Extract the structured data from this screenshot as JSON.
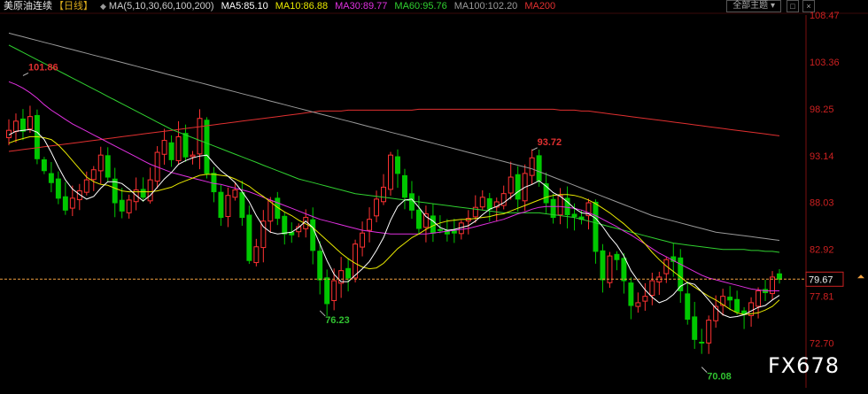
{
  "header": {
    "title": "美原油连续",
    "period": "【日线】",
    "ma_label": "MA(5,10,30,60,100,200)",
    "ma5": "MA5:85.10",
    "ma10": "MA10:86.88",
    "ma30": "MA30:89.77",
    "ma60": "MA60:95.76",
    "ma100": "MA100:102.20",
    "ma200": "MA200",
    "theme_button": "全部主题",
    "theme_icon": "chevron-down-icon",
    "icons": [
      "square-icon",
      "close-icon"
    ]
  },
  "colors": {
    "up": "#ff3232",
    "down": "#00c800",
    "ma5": "#ffffff",
    "ma10": "#e8e800",
    "ma30": "#e030e0",
    "ma60": "#30d030",
    "ma100": "#9a9a9a",
    "ma200": "#e03030",
    "last_price": "#f0a040"
  },
  "watermark": "FX678",
  "chart_data": {
    "type": "candlestick",
    "y_axis": {
      "min": 68.5,
      "max": 108.47,
      "position": "right",
      "ticks": [
        108.47,
        103.36,
        98.25,
        93.14,
        88.03,
        82.92,
        77.81,
        72.7
      ]
    },
    "last_price": 79.67,
    "annotations": [
      {
        "text": "101.86",
        "index": 2,
        "value": 101.86
      },
      {
        "text": "93.72",
        "index": 74,
        "value": 93.72
      },
      {
        "text": "76.23",
        "index": 44,
        "value": 76.23
      },
      {
        "text": "70.08",
        "index": 98,
        "value": 70.08
      }
    ],
    "close": [
      95.9,
      96.9,
      95.8,
      97.4,
      92.8,
      91.5,
      90.2,
      88.5,
      87.2,
      88.5,
      89.3,
      90.5,
      91.6,
      93.2,
      90.8,
      88.0,
      87.1,
      88.3,
      89.4,
      88.6,
      90.5,
      93.5,
      94.8,
      92.7,
      95.2,
      93.0,
      93.2,
      97.2,
      91.2,
      89.2,
      86.4,
      88.8,
      89.4,
      86.4,
      81.7,
      83.2,
      86.0,
      88.2,
      86.3,
      84.6,
      84.5,
      85.4,
      86.4,
      82.8,
      79.6,
      77.0,
      79.5,
      80.6,
      79.8,
      83.5,
      84.7,
      86.2,
      88.4,
      89.7,
      93.2,
      91.2,
      88.6,
      87.2,
      85.2,
      86.8,
      84.7,
      85.0,
      84.6,
      84.7,
      85.8,
      86.3,
      87.5,
      88.6,
      87.3,
      88.1,
      89.0,
      90.8,
      88.4,
      91.2,
      92.9,
      90.4,
      88.0,
      86.4,
      88.8,
      86.7,
      86.5,
      86.2,
      88.0,
      82.7,
      79.6,
      82.2,
      81.8,
      79.5,
      76.8,
      77.1,
      77.8,
      79.5,
      79.9,
      81.8,
      81.6,
      78.4,
      75.3,
      73.1,
      72.7,
      75.2,
      76.7,
      77.8,
      77.4,
      76.1,
      75.9,
      77.1,
      78.4,
      78.2,
      79.9,
      79.67
    ],
    "ma5": [
      95.4,
      95.8,
      95.9,
      96.0,
      95.7,
      94.9,
      93.5,
      91.9,
      90.5,
      89.5,
      88.9,
      88.4,
      88.7,
      89.6,
      90.3,
      90.3,
      90.1,
      89.5,
      88.8,
      88.2,
      88.8,
      89.7,
      90.6,
      91.3,
      92.2,
      92.6,
      92.9,
      93.1,
      93.2,
      92.3,
      91.5,
      90.9,
      90.2,
      89.2,
      88.1,
      86.6,
      85.4,
      84.8,
      84.6,
      84.7,
      84.8,
      85.3,
      86.0,
      85.3,
      83.5,
      81.7,
      80.2,
      79.4,
      79.4,
      80.1,
      80.8,
      81.6,
      82.8,
      84.2,
      86.1,
      87.6,
      88.3,
      88.4,
      87.5,
      86.5,
      86.0,
      85.3,
      85.0,
      85.1,
      85.3,
      85.5,
      86.0,
      86.7,
      87.3,
      87.6,
      88.0,
      88.6,
      89.2,
      89.7,
      90.0,
      90.4,
      89.8,
      89.1,
      88.7,
      88.1,
      87.4,
      86.9,
      86.8,
      86.3,
      85.4,
      84.3,
      83.4,
      82.2,
      80.6,
      79.5,
      78.5,
      77.7,
      77.1,
      77.4,
      78.0,
      78.9,
      79.3,
      79.1,
      78.3,
      77.4,
      76.5,
      75.8,
      75.5,
      75.6,
      75.8,
      76.2,
      76.6,
      76.8,
      77.4,
      77.9
    ],
    "ma10": [
      94.5,
      94.8,
      95.0,
      95.2,
      95.2,
      95.1,
      94.9,
      94.3,
      93.5,
      92.6,
      91.7,
      90.8,
      90.3,
      90.0,
      89.9,
      89.6,
      89.3,
      89.2,
      89.2,
      89.2,
      89.2,
      89.3,
      89.5,
      89.7,
      90.1,
      90.4,
      90.7,
      91.0,
      91.1,
      91.1,
      91.0,
      90.9,
      90.6,
      90.2,
      89.8,
      89.2,
      88.7,
      88.1,
      87.5,
      87.0,
      86.6,
      86.1,
      85.7,
      85.3,
      84.6,
      83.9,
      83.2,
      82.5,
      81.9,
      81.4,
      81.0,
      80.8,
      80.9,
      81.4,
      82.2,
      83.0,
      83.6,
      84.2,
      84.6,
      85.1,
      85.5,
      85.8,
      86.0,
      86.1,
      86.2,
      86.2,
      86.3,
      86.4,
      86.5,
      86.7,
      86.8,
      87.1,
      87.4,
      87.7,
      88.0,
      88.3,
      88.6,
      88.8,
      88.9,
      88.9,
      88.8,
      88.6,
      88.3,
      87.9,
      87.4,
      86.9,
      86.3,
      85.7,
      85.0,
      84.3,
      83.5,
      82.6,
      81.8,
      81.1,
      80.5,
      79.9,
      79.3,
      78.8,
      78.3,
      77.8,
      77.4,
      76.9,
      76.4,
      76.0,
      75.8,
      75.9,
      76.0,
      76.3,
      76.7,
      77.4
    ],
    "ma30": [
      101.2,
      100.9,
      100.5,
      100.0,
      99.4,
      98.7,
      98.1,
      97.6,
      97.1,
      96.6,
      96.2,
      95.8,
      95.4,
      95.0,
      94.6,
      94.2,
      93.8,
      93.4,
      93.0,
      92.6,
      92.2,
      91.9,
      91.6,
      91.3,
      91.1,
      90.9,
      90.7,
      90.5,
      90.3,
      90.1,
      90.0,
      89.8,
      89.6,
      89.4,
      89.2,
      88.9,
      88.6,
      88.3,
      88.0,
      87.7,
      87.4,
      87.1,
      86.8,
      86.5,
      86.2,
      86.0,
      85.8,
      85.6,
      85.4,
      85.2,
      85.0,
      84.9,
      84.8,
      84.7,
      84.6,
      84.6,
      84.6,
      84.6,
      84.6,
      84.6,
      84.7,
      84.8,
      84.9,
      85.0,
      85.1,
      85.2,
      85.4,
      85.6,
      85.8,
      86.0,
      86.2,
      86.5,
      86.8,
      87.0,
      87.3,
      87.5,
      87.6,
      87.6,
      87.6,
      87.5,
      87.4,
      87.2,
      86.9,
      86.6,
      86.2,
      85.8,
      85.4,
      84.9,
      84.5,
      84.0,
      83.5,
      83.0,
      82.5,
      82.1,
      81.7,
      81.3,
      80.9,
      80.5,
      80.1,
      79.8,
      79.6,
      79.4,
      79.2,
      79.0,
      78.8,
      78.6,
      78.5,
      78.4,
      78.4,
      78.4
    ],
    "ma60": [
      105.2,
      104.8,
      104.4,
      104.0,
      103.6,
      103.2,
      102.8,
      102.4,
      102.0,
      101.6,
      101.2,
      100.8,
      100.4,
      100.0,
      99.6,
      99.2,
      98.8,
      98.4,
      98.0,
      97.6,
      97.2,
      96.8,
      96.4,
      96.0,
      95.7,
      95.4,
      95.1,
      94.8,
      94.5,
      94.2,
      93.9,
      93.6,
      93.3,
      93.0,
      92.7,
      92.4,
      92.1,
      91.8,
      91.5,
      91.2,
      90.9,
      90.6,
      90.4,
      90.2,
      90.0,
      89.8,
      89.6,
      89.4,
      89.2,
      89.0,
      88.9,
      88.8,
      88.7,
      88.6,
      88.5,
      88.4,
      88.3,
      88.2,
      88.1,
      88.0,
      87.9,
      87.8,
      87.7,
      87.6,
      87.5,
      87.4,
      87.3,
      87.2,
      87.1,
      87.0,
      86.9,
      86.9,
      86.9,
      86.9,
      86.9,
      86.9,
      86.8,
      86.7,
      86.6,
      86.5,
      86.4,
      86.2,
      86.0,
      85.8,
      85.6,
      85.4,
      85.2,
      85.0,
      84.8,
      84.6,
      84.4,
      84.2,
      84.0,
      83.8,
      83.6,
      83.5,
      83.4,
      83.3,
      83.2,
      83.1,
      83.0,
      82.9,
      82.9,
      82.9,
      82.9,
      82.8,
      82.8,
      82.7,
      82.7,
      82.6
    ],
    "ma100": [
      106.5,
      106.3,
      106.1,
      105.9,
      105.7,
      105.5,
      105.3,
      105.1,
      104.9,
      104.7,
      104.5,
      104.3,
      104.1,
      103.9,
      103.7,
      103.5,
      103.3,
      103.1,
      102.9,
      102.7,
      102.5,
      102.3,
      102.1,
      101.9,
      101.7,
      101.5,
      101.3,
      101.1,
      100.9,
      100.7,
      100.5,
      100.3,
      100.1,
      99.9,
      99.7,
      99.5,
      99.3,
      99.1,
      98.9,
      98.7,
      98.5,
      98.3,
      98.1,
      97.9,
      97.7,
      97.5,
      97.3,
      97.1,
      96.9,
      96.7,
      96.5,
      96.3,
      96.1,
      95.9,
      95.7,
      95.5,
      95.3,
      95.1,
      94.9,
      94.7,
      94.5,
      94.3,
      94.1,
      93.9,
      93.7,
      93.5,
      93.3,
      93.1,
      92.9,
      92.7,
      92.5,
      92.3,
      92.1,
      91.9,
      91.7,
      91.4,
      91.1,
      90.8,
      90.5,
      90.2,
      89.9,
      89.6,
      89.3,
      89.0,
      88.7,
      88.4,
      88.1,
      87.8,
      87.5,
      87.2,
      86.9,
      86.6,
      86.4,
      86.2,
      86.0,
      85.8,
      85.6,
      85.4,
      85.2,
      85.0,
      84.8,
      84.7,
      84.6,
      84.5,
      84.4,
      84.3,
      84.2,
      84.1,
      84.0,
      83.9
    ],
    "ma200": [
      93.6,
      93.7,
      93.8,
      93.9,
      94.0,
      94.1,
      94.2,
      94.3,
      94.4,
      94.5,
      94.6,
      94.7,
      94.8,
      94.9,
      95.0,
      95.1,
      95.2,
      95.3,
      95.4,
      95.5,
      95.6,
      95.7,
      95.8,
      95.9,
      96.0,
      96.1,
      96.2,
      96.3,
      96.4,
      96.5,
      96.6,
      96.7,
      96.8,
      96.9,
      97.0,
      97.1,
      97.2,
      97.3,
      97.4,
      97.5,
      97.6,
      97.7,
      97.8,
      97.9,
      98.0,
      98.0,
      98.0,
      98.0,
      98.1,
      98.1,
      98.1,
      98.1,
      98.1,
      98.1,
      98.1,
      98.1,
      98.1,
      98.1,
      98.2,
      98.2,
      98.2,
      98.2,
      98.2,
      98.2,
      98.2,
      98.2,
      98.2,
      98.2,
      98.2,
      98.2,
      98.2,
      98.2,
      98.2,
      98.2,
      98.2,
      98.2,
      98.2,
      98.2,
      98.1,
      98.1,
      98.1,
      98.0,
      98.0,
      97.9,
      97.8,
      97.7,
      97.6,
      97.5,
      97.4,
      97.3,
      97.2,
      97.1,
      97.0,
      96.9,
      96.8,
      96.7,
      96.6,
      96.5,
      96.4,
      96.3,
      96.2,
      96.1,
      96.0,
      95.9,
      95.8,
      95.7,
      95.6,
      95.5,
      95.4,
      95.3
    ]
  }
}
